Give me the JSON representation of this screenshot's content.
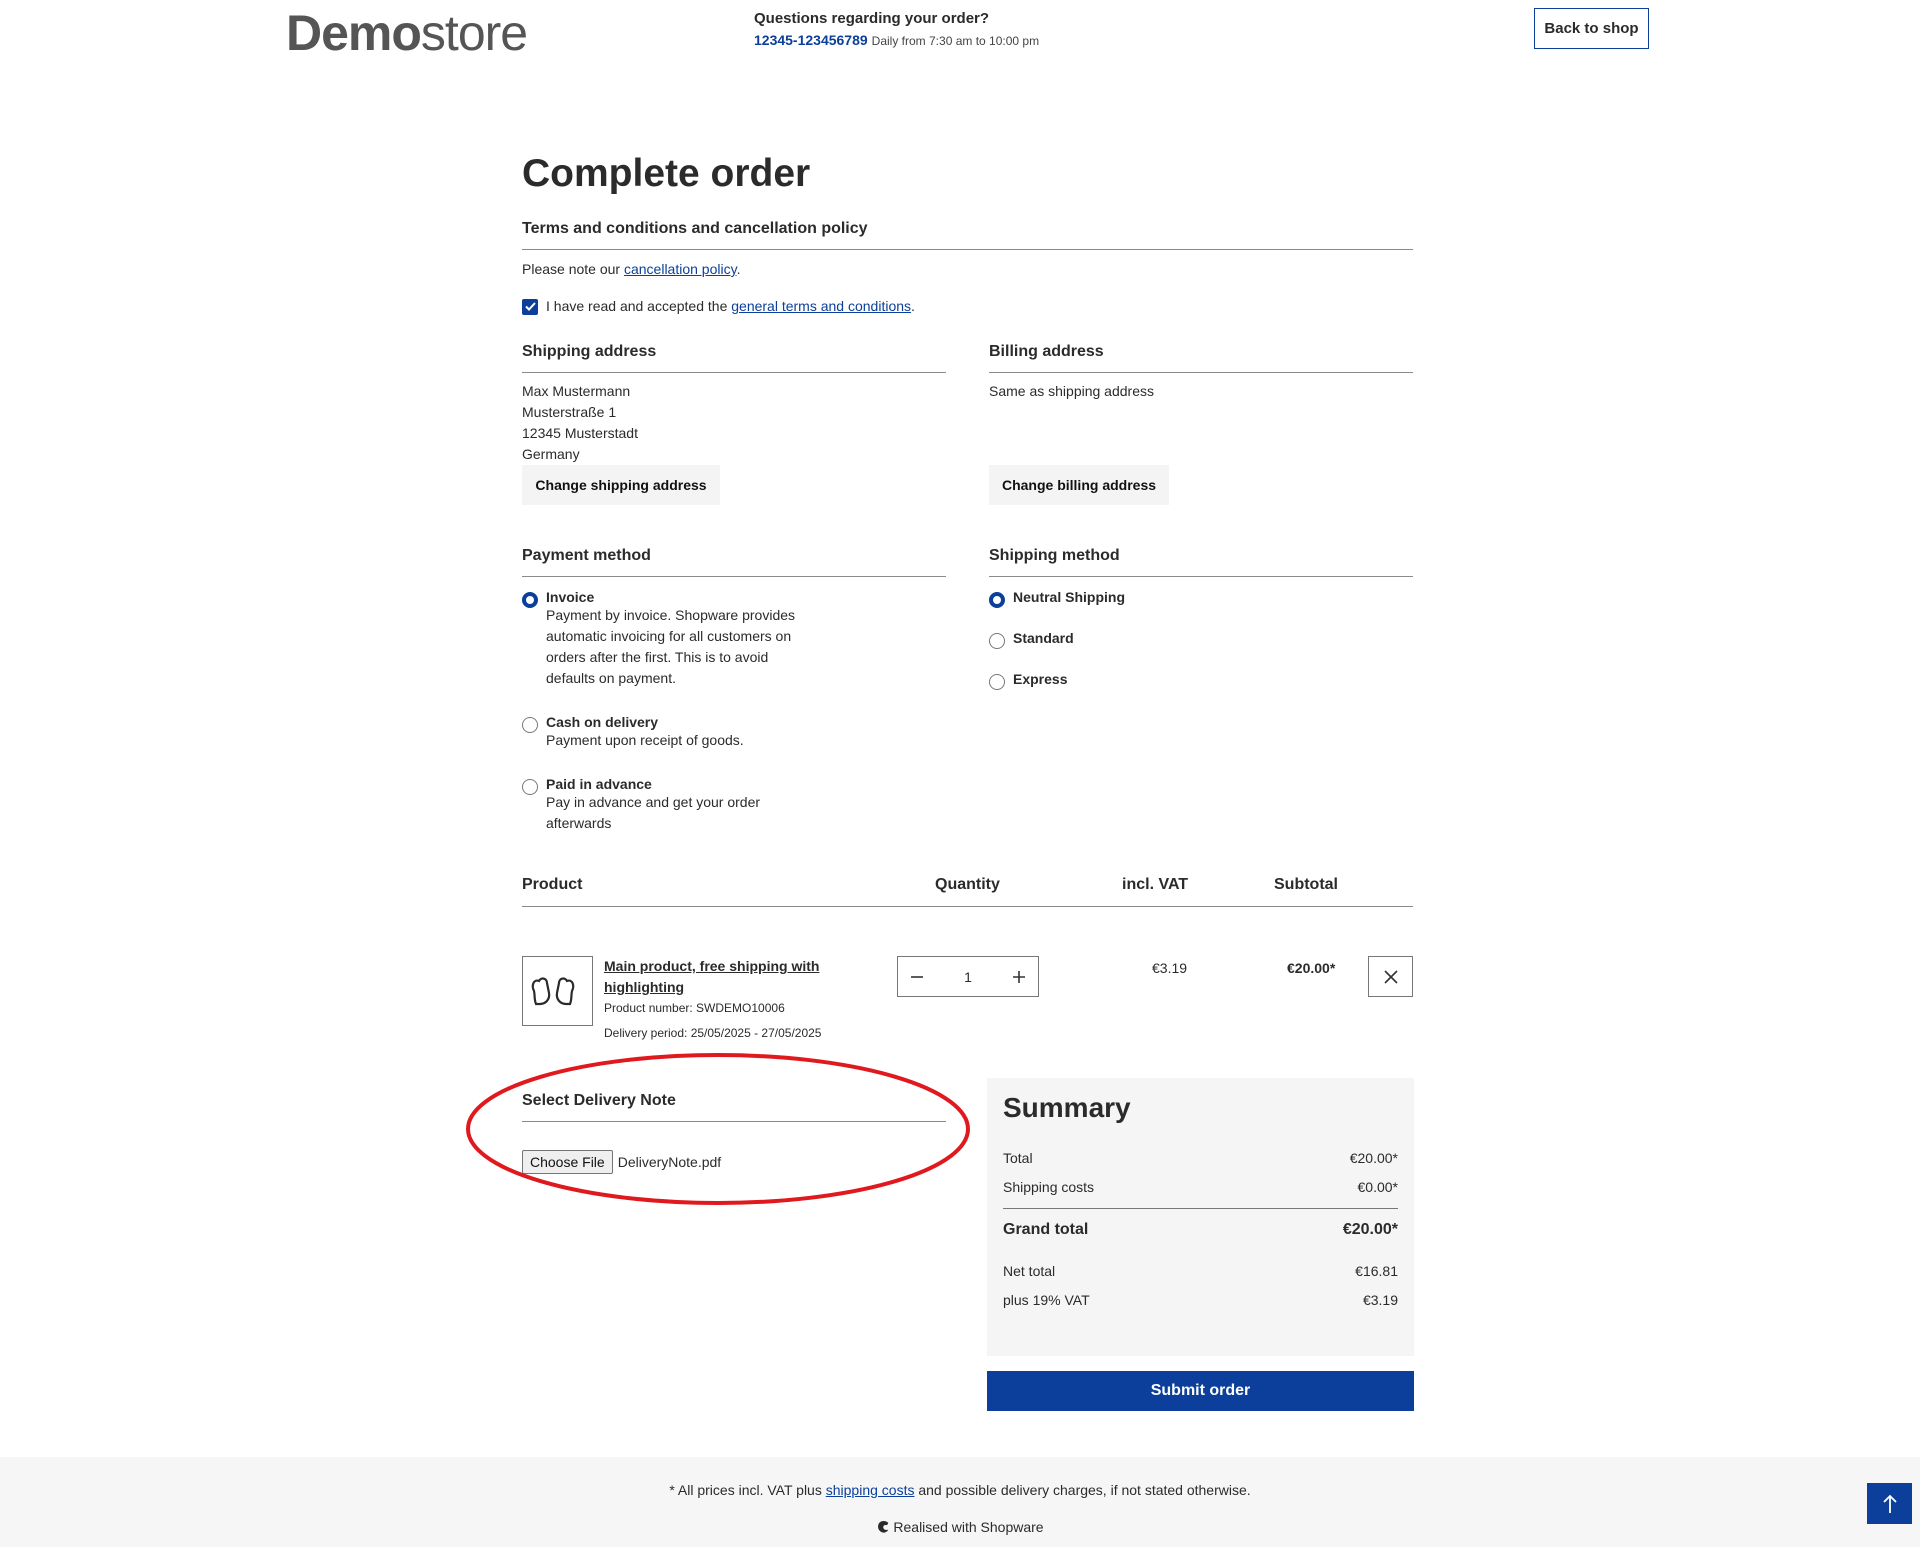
{
  "header": {
    "logo_bold": "Demo",
    "logo_light": "store",
    "contact_question": "Questions regarding your order?",
    "contact_phone": "12345-123456789",
    "contact_hours": "Daily from 7:30 am to 10:00 pm",
    "back_to_shop": "Back to shop"
  },
  "page_title": "Complete order",
  "terms": {
    "heading": "Terms and conditions and cancellation policy",
    "note_prefix": "Please note our ",
    "cancellation_link": "cancellation policy",
    "note_suffix": ".",
    "accept_prefix": "I have read and accepted the ",
    "terms_link": "general terms and conditions",
    "accept_suffix": ".",
    "accepted": true
  },
  "shipping_address": {
    "heading": "Shipping address",
    "lines": [
      "Max Mustermann",
      "Musterstraße 1",
      "12345 Musterstadt",
      "Germany"
    ],
    "change_label": "Change shipping address"
  },
  "billing_address": {
    "heading": "Billing address",
    "text": "Same as shipping address",
    "change_label": "Change billing address"
  },
  "payment": {
    "heading": "Payment method",
    "options": [
      {
        "label": "Invoice",
        "desc": "Payment by invoice. Shopware provides automatic invoicing for all customers on orders after the first. This is to avoid defaults on payment.",
        "selected": true
      },
      {
        "label": "Cash on delivery",
        "desc": "Payment upon receipt of goods.",
        "selected": false
      },
      {
        "label": "Paid in advance",
        "desc": "Pay in advance and get your order afterwards",
        "selected": false
      }
    ]
  },
  "shipping": {
    "heading": "Shipping method",
    "options": [
      {
        "label": "Neutral Shipping",
        "selected": true
      },
      {
        "label": "Standard",
        "selected": false
      },
      {
        "label": "Express",
        "selected": false
      }
    ]
  },
  "cart": {
    "headers": {
      "product": "Product",
      "quantity": "Quantity",
      "vat": "incl. VAT",
      "subtotal": "Subtotal"
    },
    "item": {
      "name": "Main product, free shipping with highlighting",
      "product_number": "Product number: SWDEMO10006",
      "delivery": "Delivery period: 25/05/2025 - 27/05/2025",
      "quantity": "1",
      "vat": "€3.19",
      "subtotal": "€20.00*",
      "image_icon": "mittens-icon"
    }
  },
  "delivery_note": {
    "heading": "Select Delivery Note",
    "button": "Choose File",
    "filename": "DeliveryNote.pdf",
    "annotation_color": "#e0191e"
  },
  "summary": {
    "heading": "Summary",
    "total_label": "Total",
    "total_value": "€20.00*",
    "shipping_label": "Shipping costs",
    "shipping_value": "€0.00*",
    "grand_label": "Grand total",
    "grand_value": "€20.00*",
    "net_label": "Net total",
    "net_value": "€16.81",
    "vat_label": "plus 19% VAT",
    "vat_value": "€3.19",
    "submit": "Submit order"
  },
  "footer": {
    "note_prefix": "* All prices incl. VAT plus ",
    "shipping_link": "shipping costs",
    "note_suffix": " and possible delivery charges, if not stated otherwise.",
    "realised": "Realised with Shopware"
  },
  "colors": {
    "accent": "#0b3f9b",
    "annotation": "#e0191e"
  }
}
